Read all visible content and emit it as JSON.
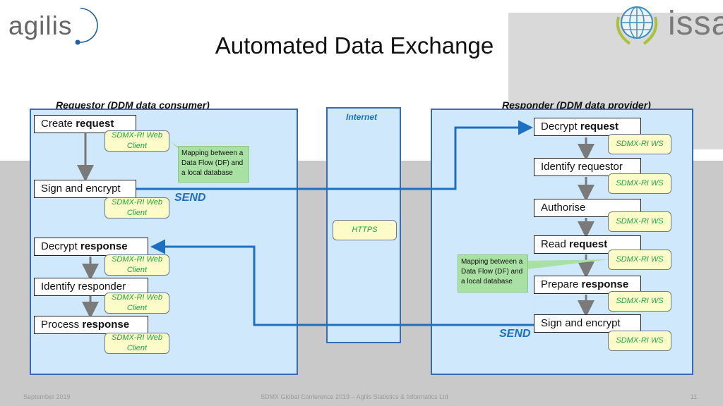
{
  "slide": {
    "title": "Automated Data Exchange",
    "logos": {
      "left": "agilis",
      "right": "issa"
    },
    "colors": {
      "panel_fill": "#cfe8fb",
      "panel_border": "#3a6ab0",
      "flow_line": "#1d6fc2",
      "tag_fill": "#fdfbc8",
      "tag_text": "#22a845",
      "note_fill": "#a9e0a3"
    }
  },
  "requestor": {
    "label": "Requestor (DDM data consumer)",
    "steps": [
      {
        "plain": "Create ",
        "bold": "request",
        "tag": [
          "SDMX-RI Web",
          "Client"
        ]
      },
      {
        "plain": "Sign and encrypt",
        "bold": "",
        "tag": [
          "SDMX-RI Web",
          "Client"
        ]
      },
      {
        "plain": "Decrypt ",
        "bold": "response",
        "tag": [
          "SDMX-RI Web",
          "Client"
        ]
      },
      {
        "plain": "Identify responder",
        "bold": "",
        "tag": [
          "SDMX-RI Web",
          "Client"
        ]
      },
      {
        "plain": "Process ",
        "bold": "response",
        "tag": [
          "SDMX-RI Web",
          "Client"
        ]
      }
    ],
    "note": [
      "Mapping between a",
      "Data Flow (DF) and",
      "a local database"
    ],
    "send_label": "SEND"
  },
  "internet": {
    "label": "Internet",
    "protocol": "HTTPS"
  },
  "responder": {
    "label": "Responder (DDM data provider)",
    "steps": [
      {
        "plain": "Decrypt ",
        "bold": "request",
        "tag": "SDMX-RI WS"
      },
      {
        "plain": "Identify requestor",
        "bold": "",
        "tag": "SDMX-RI WS"
      },
      {
        "plain": "Authorise",
        "bold": "",
        "tag": "SDMX-RI WS"
      },
      {
        "plain": "Read ",
        "bold": "request",
        "tag": "SDMX-RI WS"
      },
      {
        "plain": "Prepare ",
        "bold": "response",
        "tag": "SDMX-RI WS"
      },
      {
        "plain": "Sign and encrypt",
        "bold": "",
        "tag": "SDMX-RI WS"
      }
    ],
    "note": [
      "Mapping between a",
      "Data Flow (DF) and",
      "a local database"
    ],
    "send_label": "SEND"
  },
  "footer": {
    "date": "September 2019",
    "center": "SDMX Global Conference 2019 – Agilis Statistics & Informatics Ltd",
    "page": "11"
  }
}
